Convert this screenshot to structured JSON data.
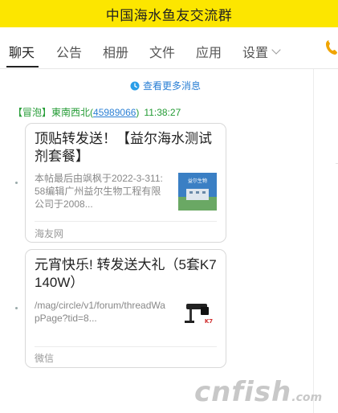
{
  "window": {
    "title": "中国海水鱼友交流群"
  },
  "tabs": [
    {
      "label": "聊天",
      "active": true
    },
    {
      "label": "公告"
    },
    {
      "label": "相册"
    },
    {
      "label": "文件"
    },
    {
      "label": "应用"
    },
    {
      "label": "设置"
    }
  ],
  "chat": {
    "more_messages": "查看更多消息",
    "sender": {
      "tag": "【冒泡】",
      "name": "東南西北",
      "qq_open": "(",
      "qq": "45989066",
      "qq_close": ")",
      "time": "11:38:27"
    },
    "cards": [
      {
        "title": "顶贴转发送！【益尔海水测试剂套餐】",
        "description": "本帖最后由飒枫于2022-3-311:58编辑广州益尔生物工程有限公司于2008...",
        "source": "海友网",
        "thumb_text": "益尔生物"
      },
      {
        "title": "元宵快乐! 转发送大礼（5套K7 140W）",
        "description": "/mag/circle/v1/forum/threadWapPage?tid=8...",
        "source": "微信",
        "thumb_text": "K7"
      }
    ]
  },
  "watermark": {
    "main": "cnfish",
    "suffix": ".com"
  },
  "colors": {
    "titlebar": "#fce600",
    "link": "#2a7fd4",
    "sender": "#239b34",
    "phone_icon": "#f0a400"
  }
}
